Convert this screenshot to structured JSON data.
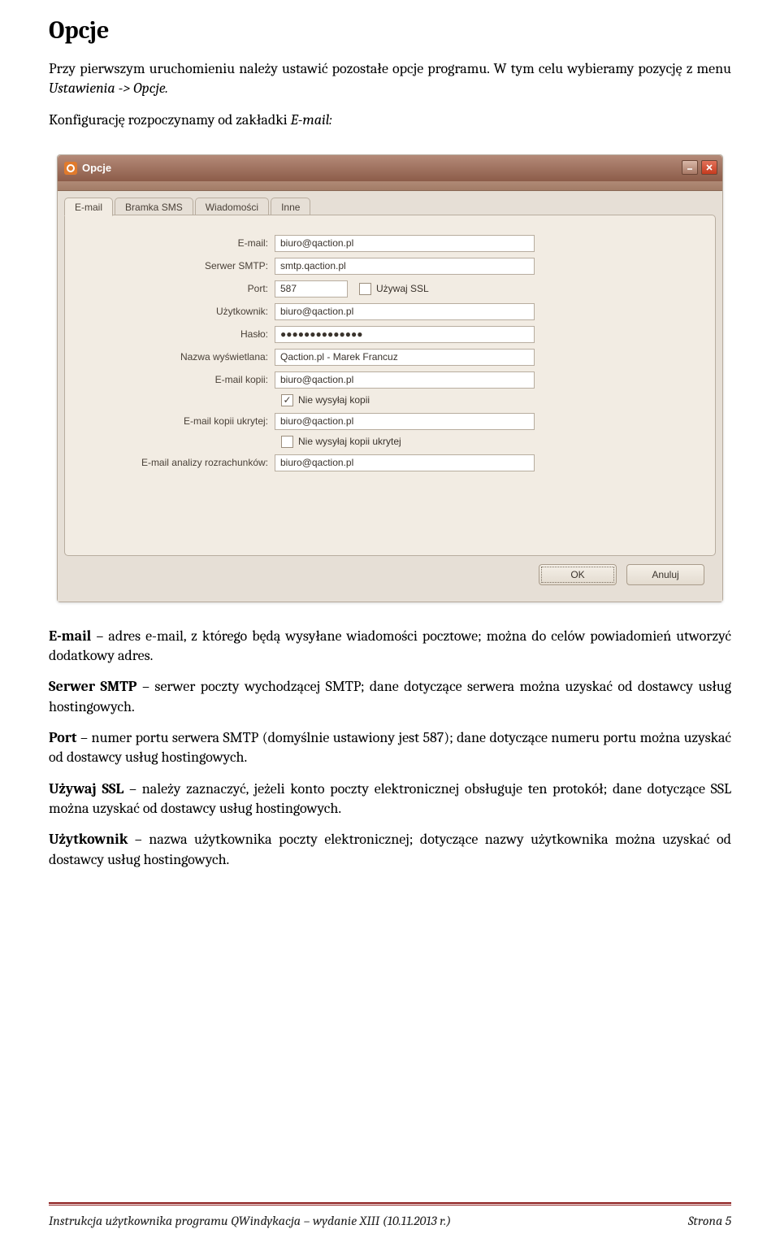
{
  "doc": {
    "heading": "Opcje",
    "p1_a": "Przy pierwszym uruchomieniu należy ustawić pozostałe opcje programu. W tym celu wybieramy pozycję z menu ",
    "p1_b": "Ustawienia -> Opcje.",
    "p2_a": "Konfigurację rozpoczynamy od zakładki ",
    "p2_b": "E-mail:",
    "p3_a": "E-mail",
    "p3_b": " – adres e-mail, z którego będą wysyłane wiadomości pocztowe; można do celów powiadomień utworzyć dodatkowy adres.",
    "p4_a": "Serwer SMTP",
    "p4_b": " – serwer poczty wychodzącej SMTP; dane dotyczące serwera można uzyskać od dostawcy usług hostingowych.",
    "p5_a": "Port",
    "p5_b": " – numer portu serwera SMTP (domyślnie ustawiony jest 587); dane dotyczące numeru portu można uzyskać od dostawcy usług hostingowych.",
    "p6_a": "Używaj SSL",
    "p6_b": " – należy zaznaczyć, jeżeli konto poczty elektronicznej obsługuje ten protokół; dane dotyczące SSL można uzyskać od dostawcy usług hostingowych.",
    "p7_a": "Użytkownik",
    "p7_b": " – nazwa użytkownika poczty elektronicznej; dotyczące nazwy użytkownika można uzyskać od dostawcy usług hostingowych."
  },
  "win": {
    "title": "Opcje",
    "tabs": [
      "E-mail",
      "Bramka SMS",
      "Wiadomości",
      "Inne"
    ],
    "form": {
      "email_label": "E-mail:",
      "email_value": "biuro@qaction.pl",
      "smtp_label": "Serwer SMTP:",
      "smtp_value": "smtp.qaction.pl",
      "port_label": "Port:",
      "port_value": "587",
      "ssl_label": "Używaj SSL",
      "user_label": "Użytkownik:",
      "user_value": "biuro@qaction.pl",
      "pass_label": "Hasło:",
      "pass_value": "●●●●●●●●●●●●●●",
      "display_label": "Nazwa wyświetlana:",
      "display_value": "Qaction.pl - Marek Francuz",
      "cc_label": "E-mail kopii:",
      "cc_value": "biuro@qaction.pl",
      "nocopy_label": "Nie wysyłaj kopii",
      "bcc_label": "E-mail kopii ukrytej:",
      "bcc_value": "biuro@qaction.pl",
      "nobcc_label": "Nie wysyłaj kopii ukrytej",
      "analysis_label": "E-mail analizy rozrachunków:",
      "analysis_value": "biuro@qaction.pl"
    },
    "ok": "OK",
    "cancel": "Anuluj"
  },
  "footer": {
    "left": "Instrukcja użytkownika programu QWindykacja – wydanie XIII (10.11.2013 r.)",
    "right": "Strona 5"
  }
}
